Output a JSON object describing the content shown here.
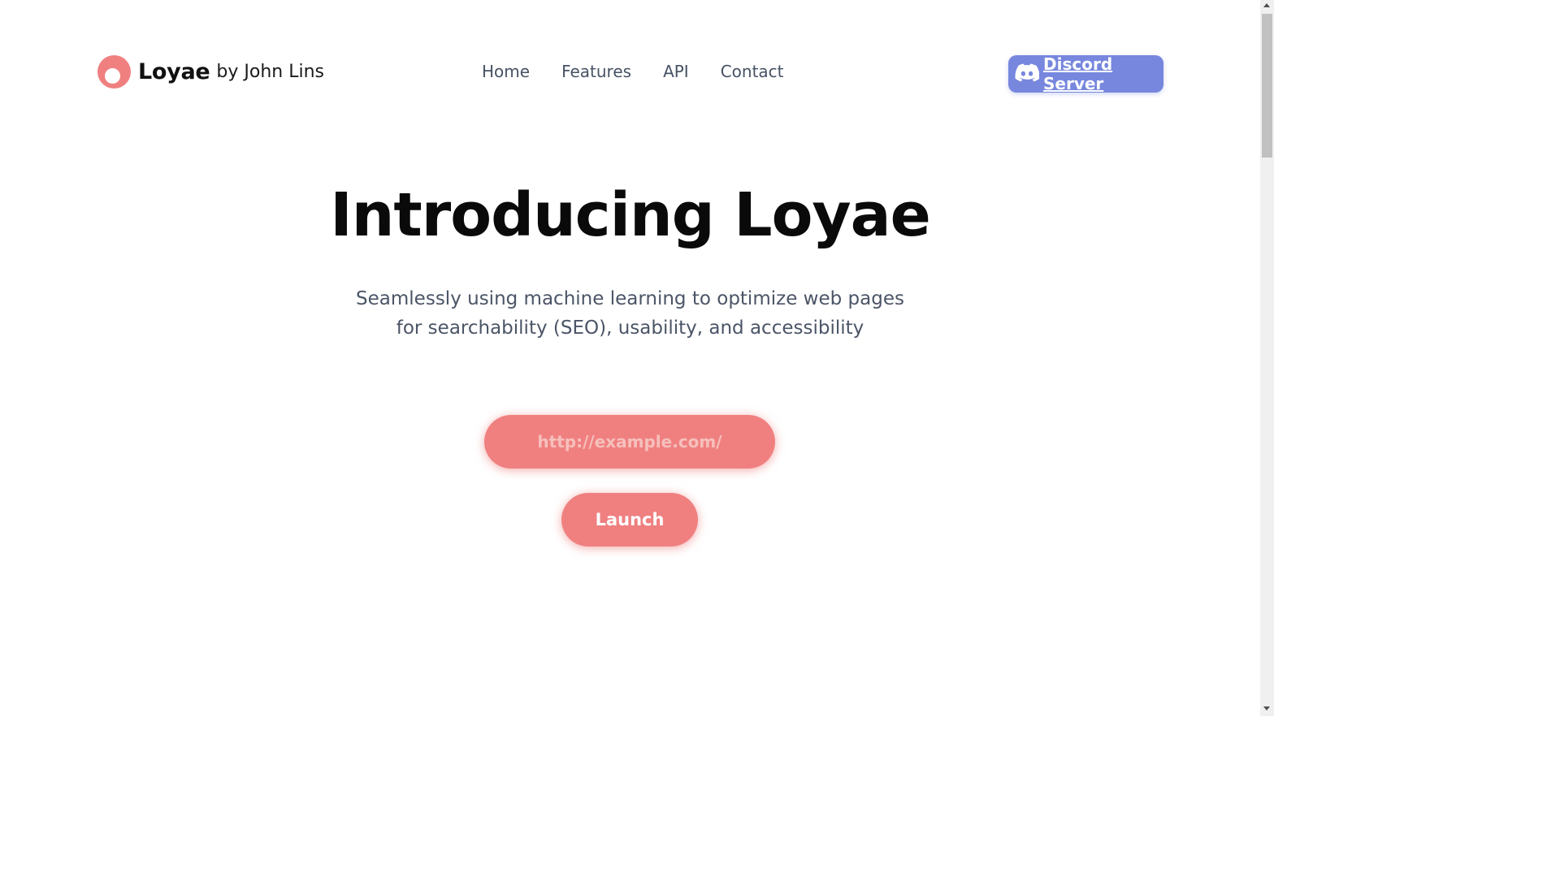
{
  "header": {
    "brand": "Loyae",
    "byline": "by John Lins",
    "nav": [
      {
        "label": "Home"
      },
      {
        "label": "Features"
      },
      {
        "label": "API"
      },
      {
        "label": "Contact"
      }
    ],
    "discord_label": "Discord Server",
    "discord_icon": "discord-icon"
  },
  "hero": {
    "title": "Introducing Loyae",
    "subtitle_line1": "Seamlessly using machine learning to optimize web pages",
    "subtitle_line2": "for searchability (SEO), usability, and accessibility",
    "url_placeholder": "http://example.com/",
    "url_value": "",
    "launch_label": "Launch"
  },
  "colors": {
    "accent": "#f08080",
    "discord": "#7787de",
    "nav_text": "#475264",
    "subtitle_text": "#4b5567"
  }
}
